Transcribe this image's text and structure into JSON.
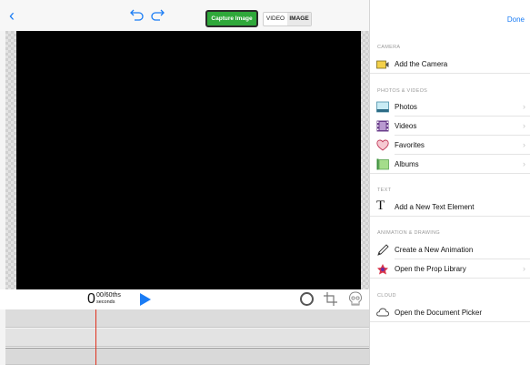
{
  "toolbar": {
    "capture_label": "Capture Image",
    "mode_video": "VIDEO",
    "mode_image": "IMAGE",
    "done_label": "Done"
  },
  "controls": {
    "time_value": "0",
    "time_fraction": "00/60ths",
    "time_unit": "seconds"
  },
  "panel": {
    "sections": {
      "camera": "CAMERA",
      "photos_videos": "PHOTOS & VIDEOS",
      "text": "TEXT",
      "animation": "ANIMATION & DRAWING",
      "cloud": "CLOUD"
    },
    "items": {
      "add_camera": "Add the Camera",
      "photos": "Photos",
      "videos": "Videos",
      "favorites": "Favorites",
      "albums": "Albums",
      "add_text": "Add a New Text Element",
      "new_animation": "Create a New Animation",
      "prop_library": "Open the Prop Library",
      "document_picker": "Open the Document Picker"
    }
  },
  "colors": {
    "accent": "#1a7cf5",
    "capture_green": "#2fa83a",
    "playhead": "#e0311e",
    "stage": "#000000"
  },
  "icons": [
    "back-chevron-icon",
    "undo-icon",
    "redo-icon",
    "play-icon",
    "record-icon",
    "crop-icon",
    "skull-icon",
    "camera-icon",
    "photos-icon",
    "videos-icon",
    "favorites-heart-icon",
    "albums-icon",
    "text-T-icon",
    "pencil-icon",
    "prop-icon",
    "cloud-icon",
    "chevron-right-icon"
  ]
}
